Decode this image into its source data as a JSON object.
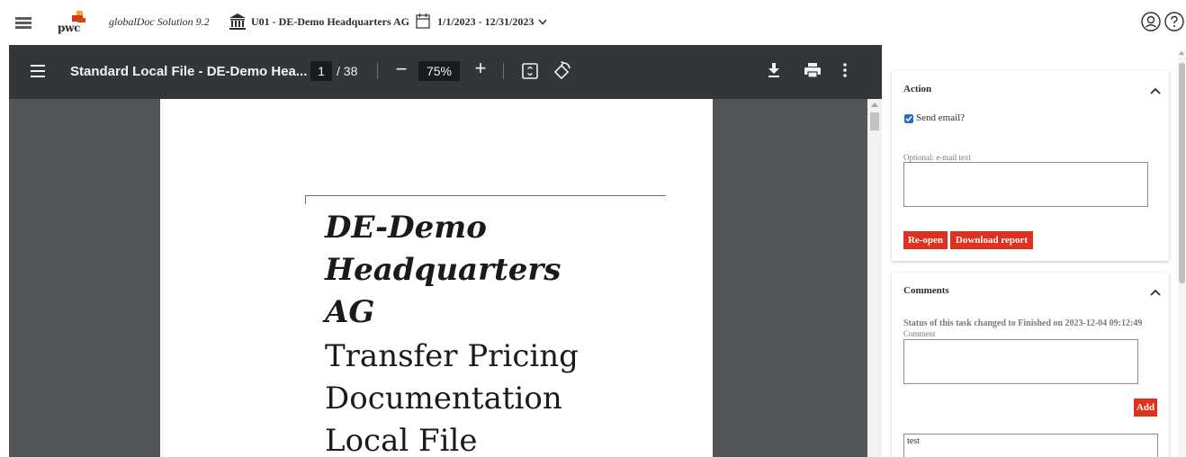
{
  "header": {
    "logo_text": "pwc",
    "app_title": "globalDoc Solution 9.2",
    "entity": "U01 - DE-Demo Headquarters AG",
    "period": "1/1/2023 - 12/31/2023"
  },
  "pdf_viewer": {
    "title": "Standard Local File - DE-Demo Hea...",
    "current_page": "1",
    "total_pages": "/ 38",
    "zoom": "75%",
    "zoom_out": "−",
    "zoom_in": "+",
    "page": {
      "heading": [
        "DE-Demo",
        "Headquarters",
        "AG"
      ],
      "subheading": [
        "Transfer Pricing",
        "Documentation",
        "Local File"
      ]
    }
  },
  "action_panel": {
    "title": "Action",
    "send_email_label": "Send email?",
    "send_email_checked": true,
    "email_text_label": "Optional: e-mail text",
    "email_text_value": "",
    "reopen_button": "Re-open",
    "download_button": "Download report"
  },
  "comments_panel": {
    "title": "Comments",
    "status_text": "Status of this task changed to Finished on 2023-12-04 09:12:49",
    "comment_label": "Comment",
    "comment_value": "",
    "add_button": "Add",
    "existing_comment": "test"
  },
  "colors": {
    "brand_red": "#e0301e",
    "checkbox_blue": "#2571c7",
    "pdf_toolbar": "#323639",
    "pdf_background": "#525659"
  },
  "icons": [
    "menu-icon",
    "pwc-logo",
    "bank-icon",
    "calendar-icon",
    "chevron-down-icon",
    "user-icon",
    "help-icon",
    "fit-page-icon",
    "rotate-icon",
    "download-icon",
    "print-icon",
    "more-icon",
    "collapse-icon"
  ]
}
